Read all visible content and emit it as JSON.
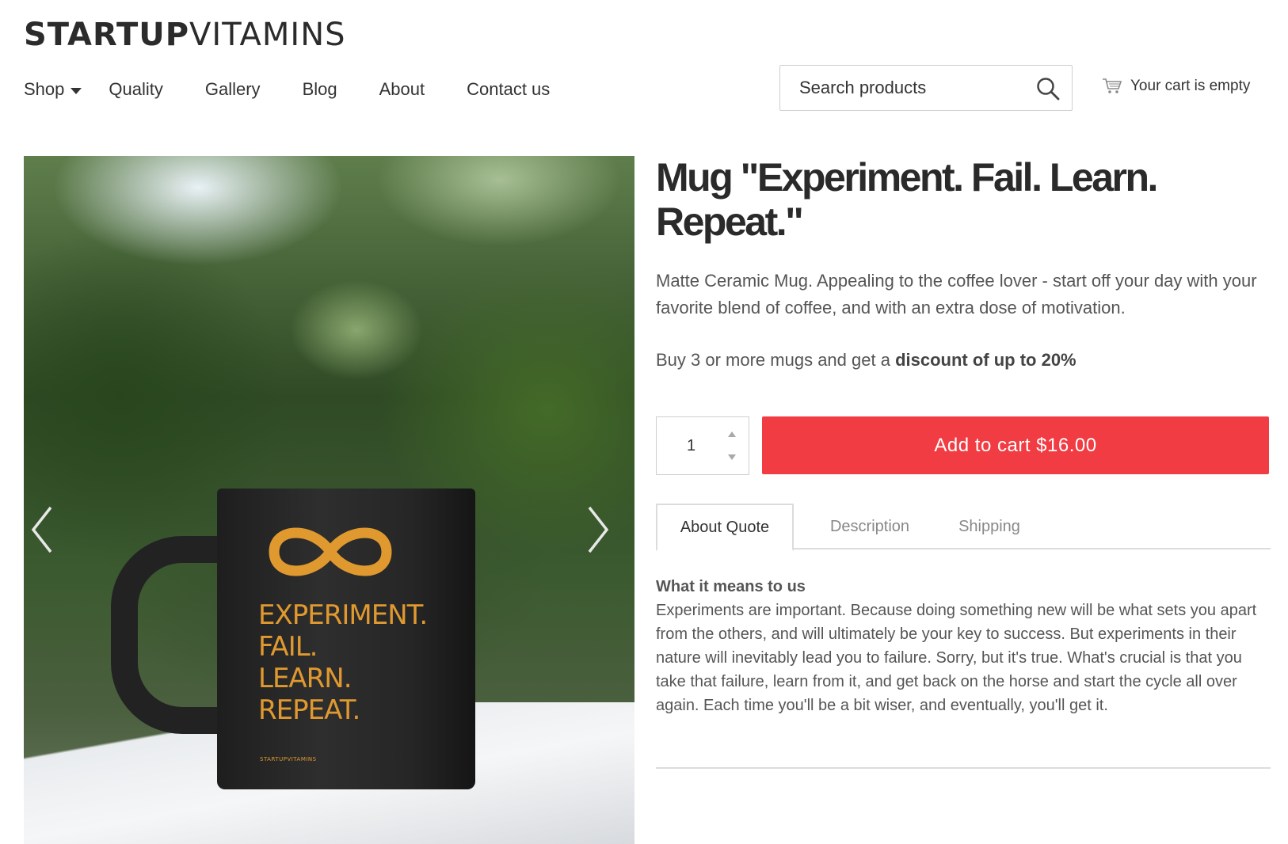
{
  "brand": {
    "logo_bold": "STARTUP",
    "logo_light": "VITAMINS"
  },
  "nav": {
    "items": [
      {
        "label": "Shop",
        "has_dropdown": true
      },
      {
        "label": "Quality"
      },
      {
        "label": "Gallery"
      },
      {
        "label": "Blog"
      },
      {
        "label": "About"
      },
      {
        "label": "Contact us"
      }
    ]
  },
  "search": {
    "placeholder": "Search products",
    "icon": "search-icon"
  },
  "cart": {
    "label": "Your cart is empty",
    "icon": "cart-icon"
  },
  "gallery": {
    "prev_icon": "chevron-left-icon",
    "next_icon": "chevron-right-icon",
    "mug_lines": [
      "EXPERIMENT.",
      "FAIL.",
      "LEARN.",
      "REPEAT."
    ],
    "mug_brand": "STARTUPVITAMINS"
  },
  "product": {
    "title": "Mug \"Experiment. Fail. Learn. Repeat.\"",
    "description": "Matte Ceramic Mug. Appealing to the coffee lover - start off your day with your favorite blend of coffee, and with an extra dose of motivation.",
    "promo_prefix": "Buy 3 or more mugs and get a ",
    "promo_bold": "discount of up to 20%",
    "quantity": "1",
    "add_to_cart_label": "Add to cart $16.00"
  },
  "tabs": [
    {
      "label": "About Quote",
      "active": true
    },
    {
      "label": "Description",
      "active": false
    },
    {
      "label": "Shipping",
      "active": false
    }
  ],
  "about_quote": {
    "heading": "What it means to us",
    "body": "Experiments are important. Because doing something new will be what sets you apart from the others, and will ultimately be your key to success. But experiments in their nature will inevitably lead you to failure. Sorry, but it's true. What's crucial is that you take that failure, learn from it, and get back on the horse and start the cycle all over again. Each time you'll be a bit wiser, and eventually, you'll get it."
  },
  "colors": {
    "accent": "#f03c42",
    "mug_text": "#e0992f",
    "text": "#333333"
  }
}
